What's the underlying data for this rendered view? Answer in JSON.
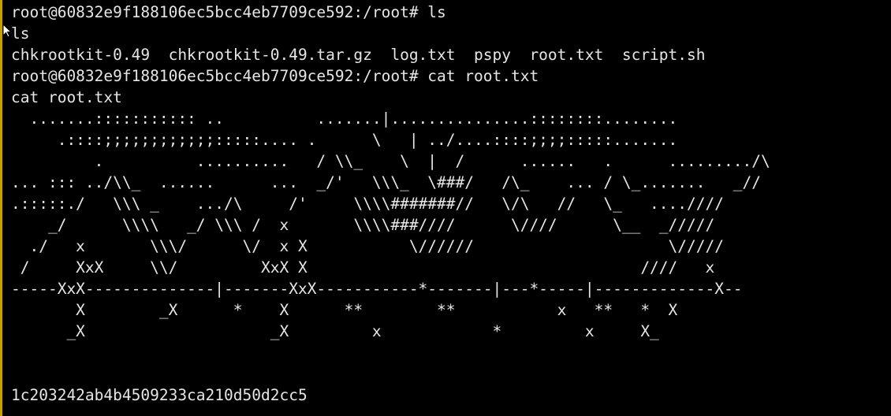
{
  "terminal": {
    "lines": [
      "root@60832e9f188106ec5bcc4eb7709ce592:/root# ls",
      "ls",
      "chkrootkit-0.49  chkrootkit-0.49.tar.gz  log.txt  pspy  root.txt  script.sh",
      "root@60832e9f188106ec5bcc4eb7709ce592:/root# cat root.txt",
      "cat root.txt",
      "  .......::::::::::: ..          .......|...............::::::::........",
      "     .::::;;;;;;;;;;;;:::::.... .      \\   | ../....::::;;;;:::::.......",
      "         .          ..........   / \\\\_    \\  |  /      ......   .      ........./\\",
      "... ::: ../\\\\_  ......      ...  _/'   \\\\\\_  \\###/   /\\_    ... / \\_.......   _//",
      ".:::::./   \\\\\\ _    .../\\     /'     \\\\\\\\#######//   \\/\\   //   \\_   ....////",
      "    _/      \\\\\\\\   _/ \\\\\\ /  x       \\\\\\\\###////      \\////      \\__  _/////",
      "  ./   x       \\\\\\/      \\/  x X           \\//////                     \\/////",
      " /     XxX     \\\\/         XxX X                                    ////   x",
      "-----XxX--------------|-------XxX-----------*-------|---*-----|-------------X--",
      "       X        _X      *    X      **        **           x   **   *  X",
      "      _X                    _X         x            *         x     X_",
      "",
      "",
      "1c203242ab4b4509233ca210d50d2cc5"
    ]
  }
}
